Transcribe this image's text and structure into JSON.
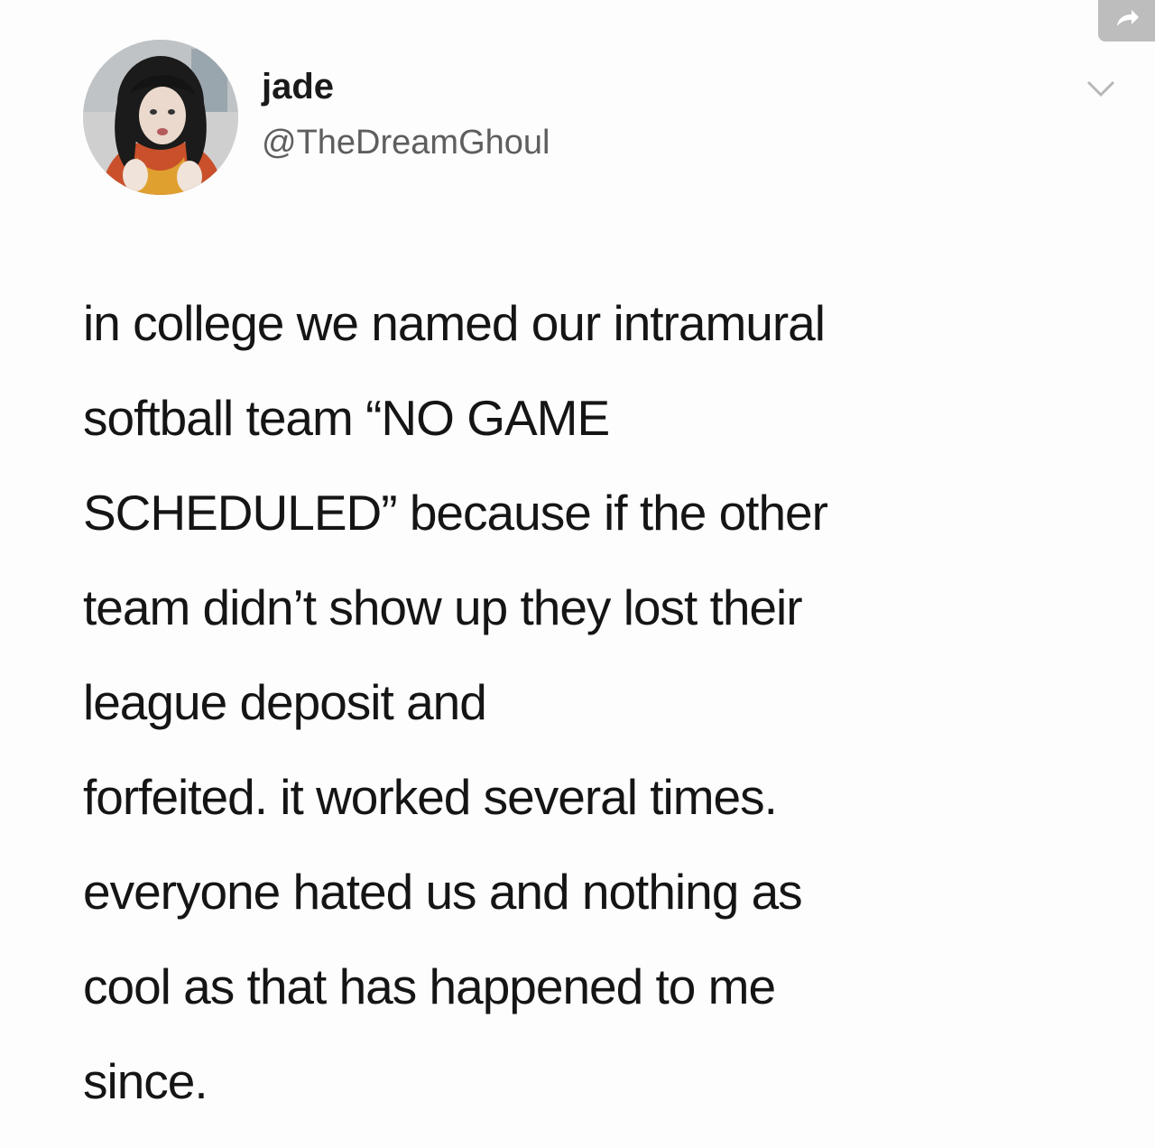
{
  "tweet": {
    "author": {
      "name": "jade",
      "handle": "@TheDreamGhoul"
    },
    "lines": [
      "in college we named our intramural",
      "softball team “NO GAME",
      "SCHEDULED” because if the other",
      "team didn’t show up they lost their",
      "league deposit and",
      "forfeited. it worked several times.",
      "everyone hated us and nothing as",
      "cool as that has happened to me",
      "since."
    ]
  },
  "icons": {
    "share": "share-arrow-icon",
    "caret": "chevron-down-icon"
  },
  "colors": {
    "background": "#fdfdfd",
    "text": "#151515",
    "handle": "#5e5e5e",
    "share_bg": "#bdbdbd",
    "caret": "#b8b8b8"
  }
}
